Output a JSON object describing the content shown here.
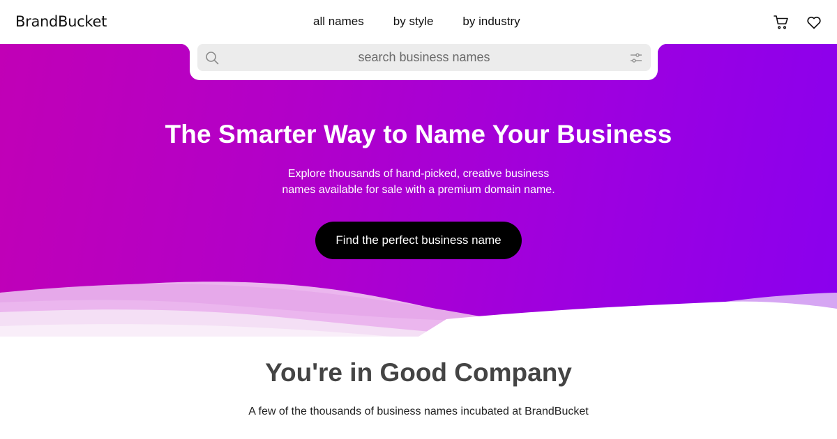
{
  "header": {
    "logo": "BrandBucket",
    "nav": [
      "all names",
      "by style",
      "by industry"
    ],
    "icons": [
      "cart-icon",
      "heart-icon"
    ]
  },
  "search": {
    "placeholder": "search business names",
    "icons": [
      "search-icon",
      "filter-icon"
    ]
  },
  "hero": {
    "title": "The Smarter Way to Name Your Business",
    "subtitle_line1": "Explore thousands of hand-picked, creative business",
    "subtitle_line2": "names available for sale with a premium domain name.",
    "cta_label": "Find the perfect business name"
  },
  "company": {
    "title": "You're in Good Company",
    "subtitle": "A few of the thousands of business names incubated at BrandBucket"
  },
  "colors": {
    "gradient_start": "#c100b6",
    "gradient_end": "#8a00ee",
    "button": "#000000",
    "search_bg": "#ececec"
  }
}
